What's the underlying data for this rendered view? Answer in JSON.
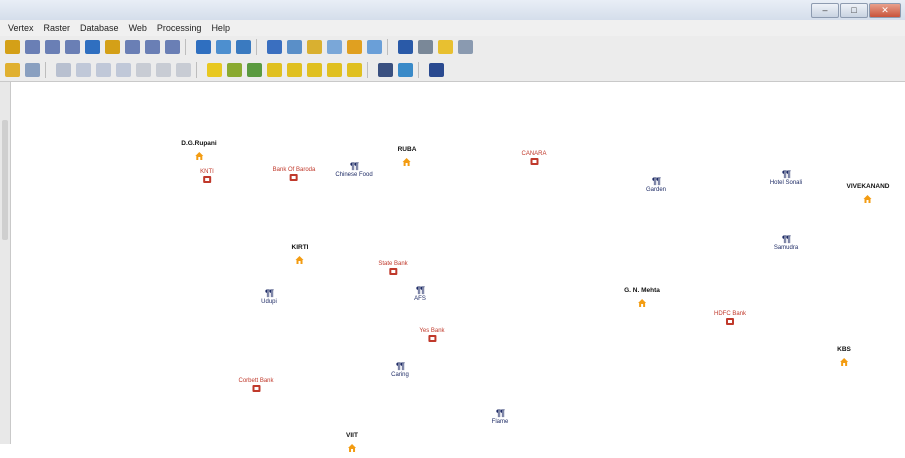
{
  "window": {
    "minimize": "–",
    "restore": "□",
    "close": "✕"
  },
  "menu": [
    "Vertex",
    "Raster",
    "Database",
    "Web",
    "Processing",
    "Help"
  ],
  "toolbar1_icons": [
    {
      "name": "pan-icon",
      "color": "#d4a017"
    },
    {
      "name": "zoom-in-icon",
      "color": "#6a7fb5"
    },
    {
      "name": "zoom-out-icon",
      "color": "#6a7fb5"
    },
    {
      "name": "zoom-native-icon",
      "color": "#6a7fb5"
    },
    {
      "name": "zoom-full-icon",
      "color": "#2f6fc0"
    },
    {
      "name": "zoom-selection-icon",
      "color": "#d4a017"
    },
    {
      "name": "zoom-layer-icon",
      "color": "#6a7fb5"
    },
    {
      "name": "zoom-last-icon",
      "color": "#6a7fb5"
    },
    {
      "name": "zoom-next-icon",
      "color": "#6a7fb5"
    },
    {
      "name": "new-map-view-icon",
      "color": "#2f6fc0"
    },
    {
      "name": "bookmark-icon",
      "color": "#4d8fcf"
    },
    {
      "name": "refresh-icon",
      "color": "#3a7ac0"
    },
    {
      "name": "identify-icon",
      "color": "#3a6fc0"
    },
    {
      "name": "select-icon",
      "color": "#5a8fc8"
    },
    {
      "name": "deselect-icon",
      "color": "#d9b030"
    },
    {
      "name": "attribute-table-icon",
      "color": "#7aa7d8"
    },
    {
      "name": "field-calculator-icon",
      "color": "#e0a020"
    },
    {
      "name": "statistics-icon",
      "color": "#6a9fd8"
    },
    {
      "name": "sum-icon",
      "color": "#2a5aa8"
    },
    {
      "name": "measure-icon",
      "color": "#7a8898"
    },
    {
      "name": "annotation-icon",
      "color": "#e8c030"
    },
    {
      "name": "text-icon",
      "color": "#8a9ab0"
    }
  ],
  "toolbar2_icons": [
    {
      "name": "toggle-edit-icon",
      "color": "#e0b030"
    },
    {
      "name": "digitize-icon",
      "color": "#8aa0c0"
    },
    {
      "name": "save-edits-icon",
      "color": "#b8c0d0"
    },
    {
      "name": "add-feature-icon",
      "color": "#c0c8d8"
    },
    {
      "name": "move-feature-icon",
      "color": "#c0c8d8"
    },
    {
      "name": "node-tool-icon",
      "color": "#c0c8d8"
    },
    {
      "name": "delete-icon",
      "color": "#c8ccd4"
    },
    {
      "name": "cut-icon",
      "color": "#c8ccd4"
    },
    {
      "name": "copy-icon",
      "color": "#c8ccd4"
    },
    {
      "name": "label-icon",
      "color": "#e8c820"
    },
    {
      "name": "label-pin-icon",
      "color": "#8aaa30"
    },
    {
      "name": "label-move-icon",
      "color": "#5a9a40"
    },
    {
      "name": "label-rotate-icon",
      "color": "#e0c020"
    },
    {
      "name": "label-change-icon",
      "color": "#e0c020"
    },
    {
      "name": "label-show-icon",
      "color": "#e0c020"
    },
    {
      "name": "label-hide-icon",
      "color": "#e0c020"
    },
    {
      "name": "label-diagram-icon",
      "color": "#e0c020"
    },
    {
      "name": "plugin-icon",
      "color": "#3a5080"
    },
    {
      "name": "python-icon",
      "color": "#3a8ac8"
    },
    {
      "name": "panel-icon",
      "color": "#2a4a90"
    }
  ],
  "features": [
    {
      "label": "D.G.Rupani",
      "style": "black",
      "icon": "house"
    },
    {
      "label": "KNTI",
      "style": "red",
      "icon": "red"
    },
    {
      "label": "Bank Of Baroda",
      "style": "red",
      "icon": "red"
    },
    {
      "label": "Chinese Food",
      "style": "navy",
      "icon": "fork"
    },
    {
      "label": "RUBA",
      "style": "black",
      "icon": "house"
    },
    {
      "label": "CANARA",
      "style": "red",
      "icon": "red"
    },
    {
      "label": "Garden",
      "style": "navy",
      "icon": "fork"
    },
    {
      "label": "Hotel Sonali",
      "style": "navy",
      "icon": "fork"
    },
    {
      "label": "VIVEKANAND",
      "style": "black",
      "icon": "house"
    },
    {
      "label": "KIRTI",
      "style": "black",
      "icon": "house"
    },
    {
      "label": "State Bank",
      "style": "red",
      "icon": "red"
    },
    {
      "label": "Samudra",
      "style": "navy",
      "icon": "fork"
    },
    {
      "label": "Udupi",
      "style": "navy",
      "icon": "fork"
    },
    {
      "label": "AFS",
      "style": "navy",
      "icon": "fork"
    },
    {
      "label": "G. N. Mehta",
      "style": "black",
      "icon": "house"
    },
    {
      "label": "HDFC Bank",
      "style": "red",
      "icon": "red"
    },
    {
      "label": "Yes Bank",
      "style": "red",
      "icon": "red"
    },
    {
      "label": "KBS",
      "style": "black",
      "icon": "house"
    },
    {
      "label": "Caring",
      "style": "navy",
      "icon": "fork"
    },
    {
      "label": "Corbett Bank",
      "style": "red",
      "icon": "red"
    },
    {
      "label": "Flame",
      "style": "navy",
      "icon": "fork"
    },
    {
      "label": "VIIT",
      "style": "black",
      "icon": "house"
    }
  ]
}
